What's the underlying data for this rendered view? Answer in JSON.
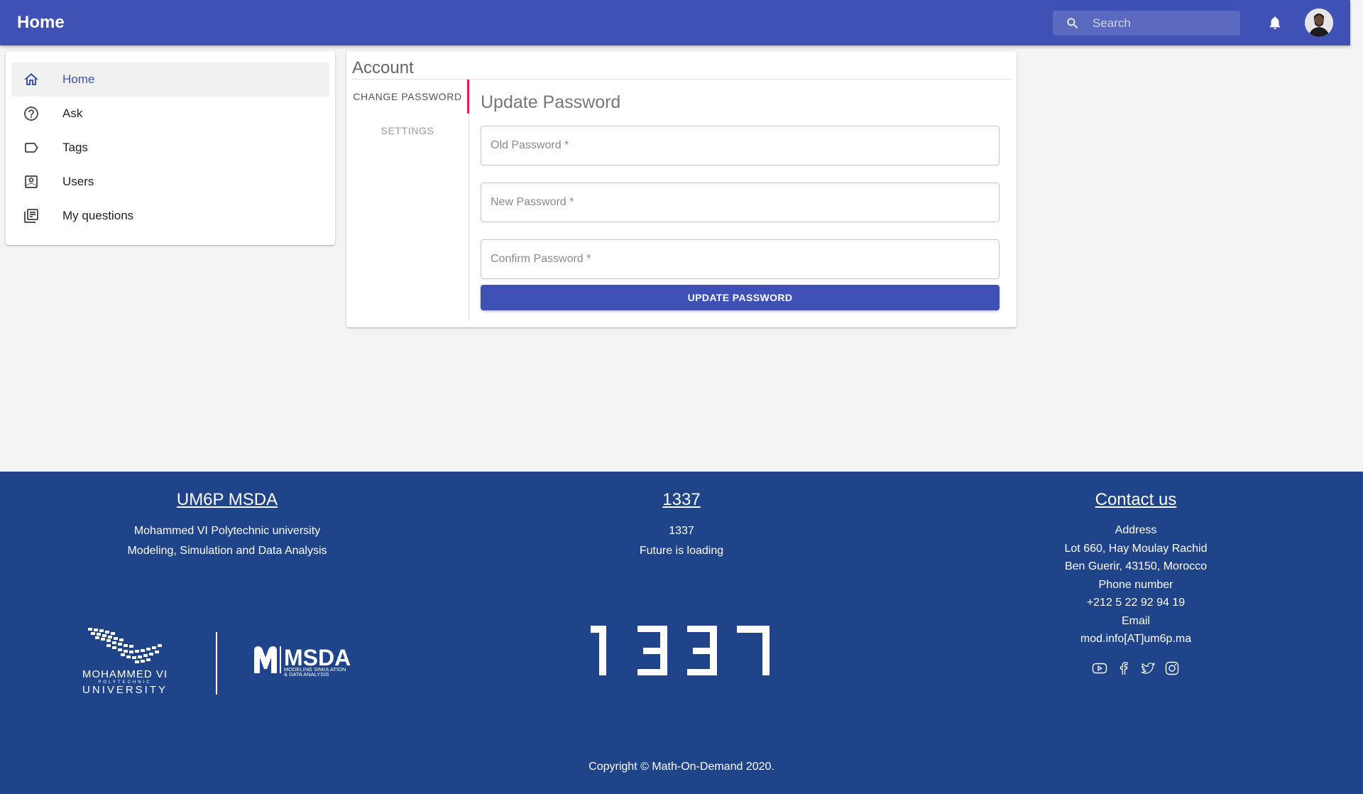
{
  "appbar": {
    "title": "Home",
    "search_placeholder": "Search"
  },
  "sidebar": {
    "items": [
      {
        "label": "Home",
        "icon": "home-icon"
      },
      {
        "label": "Ask",
        "icon": "help-circle-icon"
      },
      {
        "label": "Tags",
        "icon": "label-icon"
      },
      {
        "label": "Users",
        "icon": "account-box-icon"
      },
      {
        "label": "My questions",
        "icon": "library-books-icon"
      }
    ]
  },
  "account": {
    "title": "Account",
    "tabs": [
      "CHANGE PASSWORD",
      "SETTINGS"
    ],
    "panel_title": "Update Password",
    "fields": {
      "old": "Old Password *",
      "new": "New Password *",
      "confirm": "Confirm Password *"
    },
    "submit_label": "UPDATE PASSWORD"
  },
  "footer": {
    "col1": {
      "heading": "UM6P MSDA",
      "lines": [
        "Mohammed VI Polytechnic university",
        "Modeling, Simulation and Data Analysis"
      ]
    },
    "col2": {
      "heading": "1337",
      "lines": [
        "1337",
        "Future is loading"
      ]
    },
    "col3": {
      "heading": "Contact us",
      "lines": [
        "Address",
        "Lot 660, Hay Moulay Rachid",
        "Ben Guerir, 43150, Morocco",
        "Phone number",
        "+212 5 22 92 94 19",
        "Email",
        "mod.info[AT]um6p.ma"
      ]
    },
    "logos": {
      "um6p": [
        "MOHAMMED VI",
        "POLYTECHNIC",
        "UNIVERSITY"
      ],
      "msda": [
        "MSDA",
        "MODELING SIMULATION",
        "& DATA ANALYSIS"
      ]
    },
    "copyright": "Copyright © Math-On-Demand 2020."
  },
  "colors": {
    "primary": "#3f51b5",
    "footer": "#1f4489",
    "tab_indicator": "#e91e63"
  }
}
